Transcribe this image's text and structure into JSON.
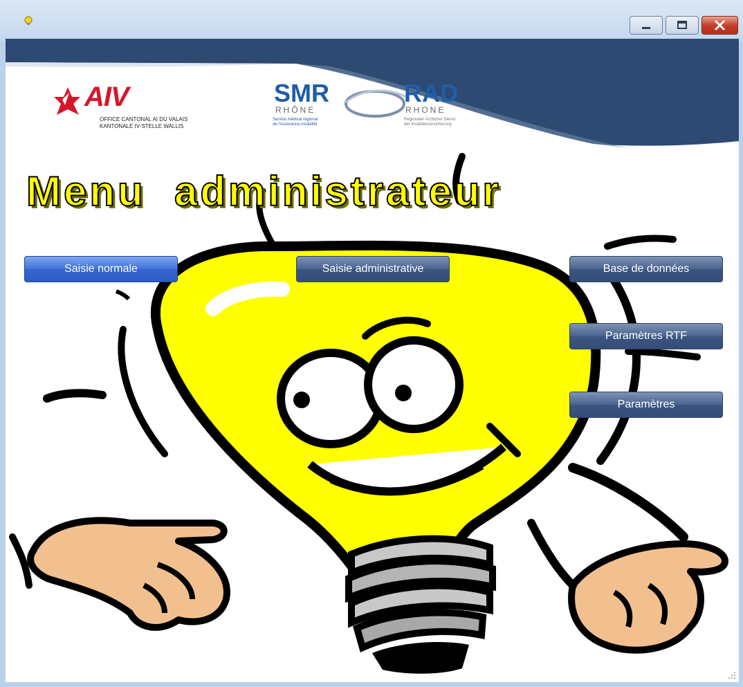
{
  "window": {
    "title": "",
    "icon": "lightbulb-icon",
    "controls": {
      "minimize": "minimize-icon",
      "maximize": "maximize-icon",
      "close": "close-icon"
    }
  },
  "banner": {
    "logo_left": {
      "wordmark": "AIV",
      "subtitle_lines": [
        "OFFICE CANTONAL AI DU VALAIS",
        "KANTONALE IV-STELLE WALLIS"
      ]
    },
    "logo_center": {
      "left_wordmark": "SMR",
      "left_sub": "RHÔNE",
      "left_caption_lines": [
        "Service médical régional",
        "de l'Assurance-invalidité"
      ],
      "right_wordmark": "RAD",
      "right_sub": "RHONE",
      "right_caption_lines": [
        "Regionaler Ärztlicher Dienst",
        "der Invalidenversicherung"
      ]
    }
  },
  "heading": "Menu  administrateur",
  "buttons": {
    "saisie_normale": "Saisie normale",
    "saisie_administrative": "Saisie administrative",
    "base_de_donnees": "Base de données",
    "parametres_rtf": "Paramètres RTF",
    "parametres": "Paramètres"
  },
  "colors": {
    "heading_fill": "#ffff00",
    "banner_navy": "#2c4a72",
    "bulb_yellow": "#ffff00",
    "button_blue": "#4b6590",
    "button_active": "#3a6bd6",
    "skin": "#f2c08f"
  }
}
